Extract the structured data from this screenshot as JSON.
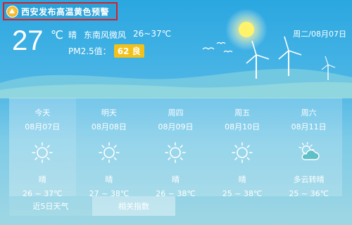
{
  "alert": {
    "text": "西安发布高温黄色预警",
    "icon": "warning-icon",
    "border_color": "#d81e2a"
  },
  "current": {
    "temperature": "27",
    "unit": "℃",
    "condition": "晴",
    "wind": "东南风微风",
    "range": "26~37℃",
    "pm_label": "PM2.5值：",
    "pm_value": "62 良",
    "pm_color": "#f3c11a",
    "date": "周二/08月07日"
  },
  "forecast": [
    {
      "name": "今天",
      "date": "08月07日",
      "icon": "sun-icon",
      "condition": "晴",
      "range": "26 ~ 37℃"
    },
    {
      "name": "明天",
      "date": "08月08日",
      "icon": "sun-icon",
      "condition": "晴",
      "range": "27 ~ 38℃"
    },
    {
      "name": "周四",
      "date": "08月09日",
      "icon": "sun-icon",
      "condition": "晴",
      "range": "26 ~ 38℃"
    },
    {
      "name": "周五",
      "date": "08月10日",
      "icon": "sun-icon",
      "condition": "晴",
      "range": "25 ~ 38℃"
    },
    {
      "name": "周六",
      "date": "08月11日",
      "icon": "partly-cloudy-icon",
      "condition": "多云转晴",
      "range": "25 ~ 36℃"
    }
  ],
  "tabs": {
    "five_day": "近5日天气",
    "index": "相关指数"
  }
}
